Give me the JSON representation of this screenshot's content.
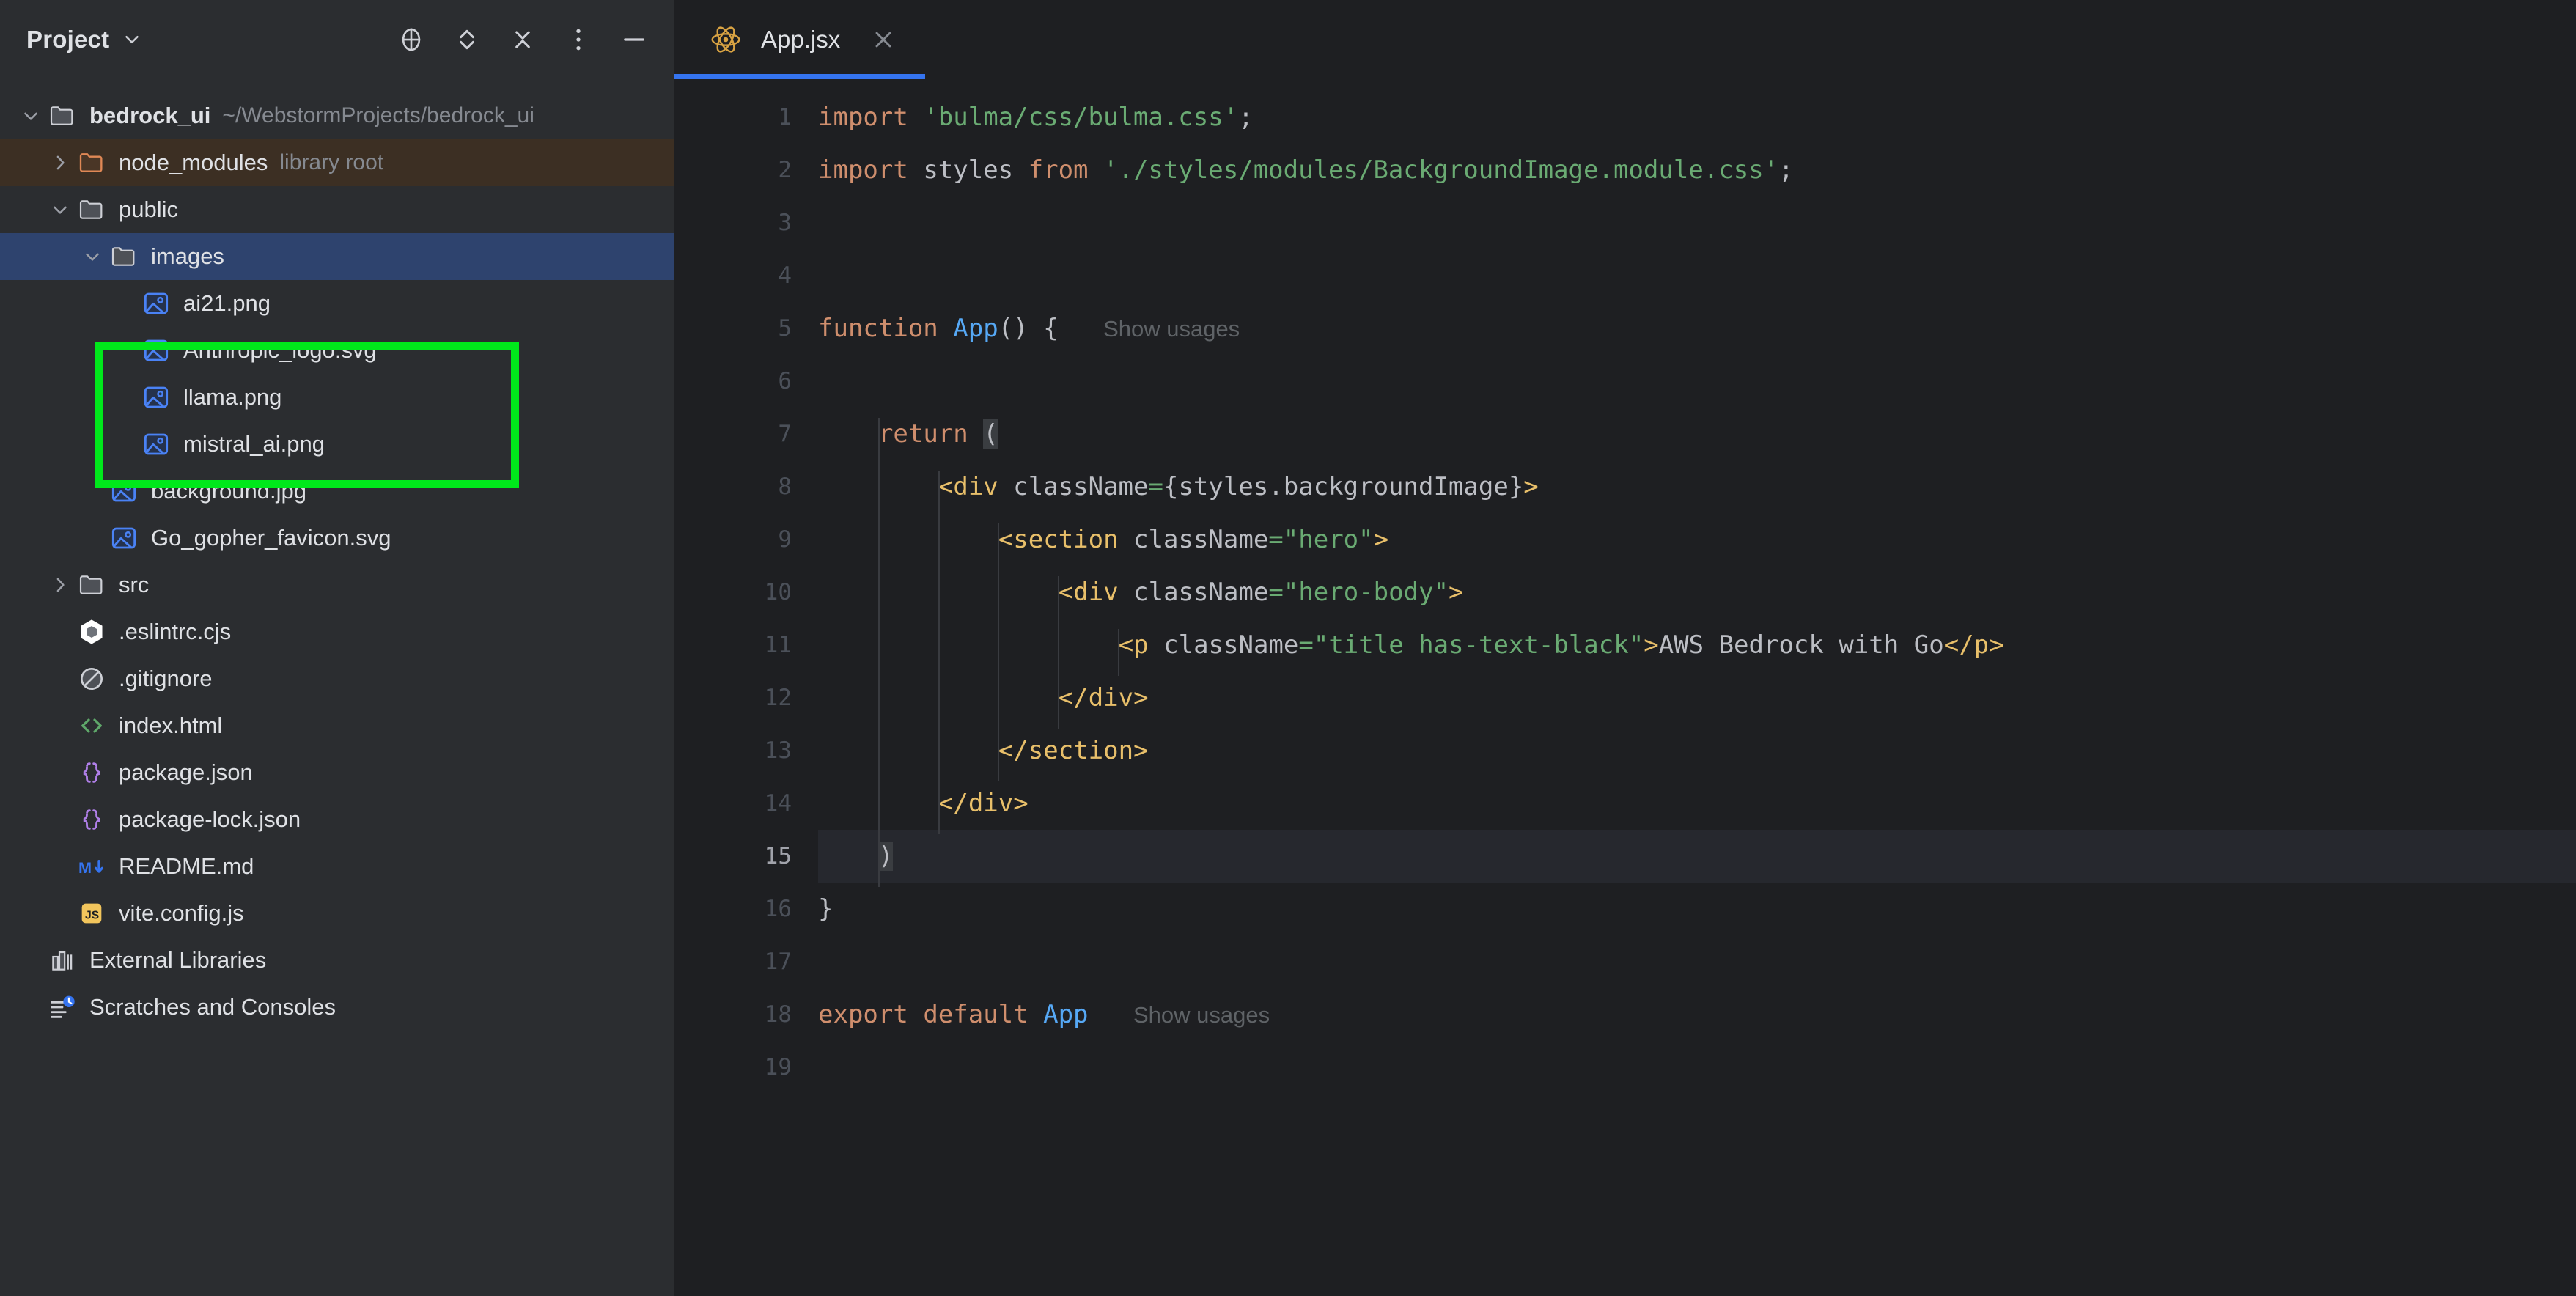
{
  "project_panel": {
    "title": "Project",
    "title_chevron_icon": "chevron-down-icon",
    "actions": [
      {
        "name": "select-opened-file-icon",
        "label": "Select Opened File"
      },
      {
        "name": "expand-collapse-icon",
        "label": "Expand / Collapse"
      },
      {
        "name": "collapse-all-icon",
        "label": "Collapse All"
      },
      {
        "name": "more-options-icon",
        "label": "Options"
      },
      {
        "name": "hide-icon",
        "label": "Hide"
      }
    ],
    "tree": [
      {
        "label": "bedrock_ui",
        "sublabel": "~/WebstormProjects/bedrock_ui",
        "icon": "folder-icon",
        "arrow": "expanded",
        "indent": 0,
        "bold": true,
        "state": "normal"
      },
      {
        "label": "node_modules",
        "sublabel": "library root",
        "icon": "folder-orange-icon",
        "arrow": "collapsed",
        "indent": 1,
        "bold": false,
        "state": "library"
      },
      {
        "label": "public",
        "sublabel": "",
        "icon": "folder-icon",
        "arrow": "expanded",
        "indent": 1,
        "bold": false,
        "state": "normal"
      },
      {
        "label": "images",
        "sublabel": "",
        "icon": "folder-icon",
        "arrow": "expanded",
        "indent": 2,
        "bold": false,
        "state": "selected"
      },
      {
        "label": "ai21.png",
        "sublabel": "",
        "icon": "image-file-icon",
        "arrow": "none",
        "indent": 3,
        "bold": false,
        "state": "normal"
      },
      {
        "label": "Anthropic_logo.svg",
        "sublabel": "",
        "icon": "image-file-icon",
        "arrow": "none",
        "indent": 3,
        "bold": false,
        "state": "normal"
      },
      {
        "label": "llama.png",
        "sublabel": "",
        "icon": "image-file-icon",
        "arrow": "none",
        "indent": 3,
        "bold": false,
        "state": "normal"
      },
      {
        "label": "mistral_ai.png",
        "sublabel": "",
        "icon": "image-file-icon",
        "arrow": "none",
        "indent": 3,
        "bold": false,
        "state": "normal"
      },
      {
        "label": "background.jpg",
        "sublabel": "",
        "icon": "image-file-icon",
        "arrow": "none",
        "indent": 2,
        "bold": false,
        "state": "normal"
      },
      {
        "label": "Go_gopher_favicon.svg",
        "sublabel": "",
        "icon": "image-file-icon",
        "arrow": "none",
        "indent": 2,
        "bold": false,
        "state": "normal"
      },
      {
        "label": "src",
        "sublabel": "",
        "icon": "folder-icon",
        "arrow": "collapsed",
        "indent": 1,
        "bold": false,
        "state": "normal"
      },
      {
        "label": ".eslintrc.cjs",
        "sublabel": "",
        "icon": "eslint-icon",
        "arrow": "none",
        "indent": 1,
        "bold": false,
        "state": "normal"
      },
      {
        "label": ".gitignore",
        "sublabel": "",
        "icon": "gitignore-icon",
        "arrow": "none",
        "indent": 1,
        "bold": false,
        "state": "normal"
      },
      {
        "label": "index.html",
        "sublabel": "",
        "icon": "html-file-icon",
        "arrow": "none",
        "indent": 1,
        "bold": false,
        "state": "normal"
      },
      {
        "label": "package.json",
        "sublabel": "",
        "icon": "json-file-icon",
        "arrow": "none",
        "indent": 1,
        "bold": false,
        "state": "normal"
      },
      {
        "label": "package-lock.json",
        "sublabel": "",
        "icon": "json-file-icon",
        "arrow": "none",
        "indent": 1,
        "bold": false,
        "state": "normal"
      },
      {
        "label": "README.md",
        "sublabel": "",
        "icon": "markdown-file-icon",
        "arrow": "none",
        "indent": 1,
        "bold": false,
        "state": "normal"
      },
      {
        "label": "vite.config.js",
        "sublabel": "",
        "icon": "js-file-icon",
        "arrow": "none",
        "indent": 1,
        "bold": false,
        "state": "normal"
      },
      {
        "label": "External Libraries",
        "sublabel": "",
        "icon": "external-libraries-icon",
        "arrow": "none",
        "indent": 0,
        "bold": false,
        "state": "normal"
      },
      {
        "label": "Scratches and Consoles",
        "sublabel": "",
        "icon": "scratches-icon",
        "arrow": "none",
        "indent": 0,
        "bold": false,
        "state": "normal"
      }
    ],
    "annotation": {
      "shape": "rectangle",
      "color": "#00E81B",
      "targets": [
        "images",
        "ai21.png",
        "Anthropic_logo.svg",
        "llama.png",
        "mistral_ai.png"
      ]
    }
  },
  "editor": {
    "tabs": [
      {
        "label": "App.jsx",
        "icon": "react-jsx-icon",
        "close_icon": "close-icon",
        "active": true
      }
    ],
    "line_numbers": [
      "1",
      "2",
      "3",
      "4",
      "5",
      "6",
      "7",
      "8",
      "9",
      "10",
      "11",
      "12",
      "13",
      "14",
      "15",
      "16",
      "17",
      "18",
      "19"
    ],
    "current_line": 15,
    "inlay_hints": [
      "Show usages"
    ],
    "lines": [
      {
        "n": 1,
        "text": "import 'bulma/css/bulma.css';"
      },
      {
        "n": 2,
        "text": "import styles from './styles/modules/BackgroundImage.module.css';"
      },
      {
        "n": 3,
        "text": ""
      },
      {
        "n": 4,
        "text": ""
      },
      {
        "n": 5,
        "text": "function App() {   Show usages"
      },
      {
        "n": 6,
        "text": ""
      },
      {
        "n": 7,
        "text": "    return ("
      },
      {
        "n": 8,
        "text": "        <div className={styles.backgroundImage}>"
      },
      {
        "n": 9,
        "text": "            <section className=\"hero\">"
      },
      {
        "n": 10,
        "text": "                <div className=\"hero-body\">"
      },
      {
        "n": 11,
        "text": "                    <p className=\"title has-text-black\">AWS Bedrock with Go</p>"
      },
      {
        "n": 12,
        "text": "                </div>"
      },
      {
        "n": 13,
        "text": "            </section>"
      },
      {
        "n": 14,
        "text": "        </div>"
      },
      {
        "n": 15,
        "text": "    )"
      },
      {
        "n": 16,
        "text": "}"
      },
      {
        "n": 17,
        "text": ""
      },
      {
        "n": 18,
        "text": "export default App   Show usages"
      },
      {
        "n": 19,
        "text": ""
      }
    ]
  },
  "colors": {
    "panel_bg": "#2B2D30",
    "editor_bg": "#1E1F22",
    "selection_blue": "#2E436E",
    "library_brown": "#3C2F23",
    "accent_blue": "#3574F0",
    "keyword_orange": "#CF8E6D",
    "string_green": "#6AAB73",
    "tag_yellow": "#E8BF6A",
    "function_blue": "#56A8F5",
    "text_default": "#BCBEC4",
    "annotation_green": "#00E81B"
  }
}
